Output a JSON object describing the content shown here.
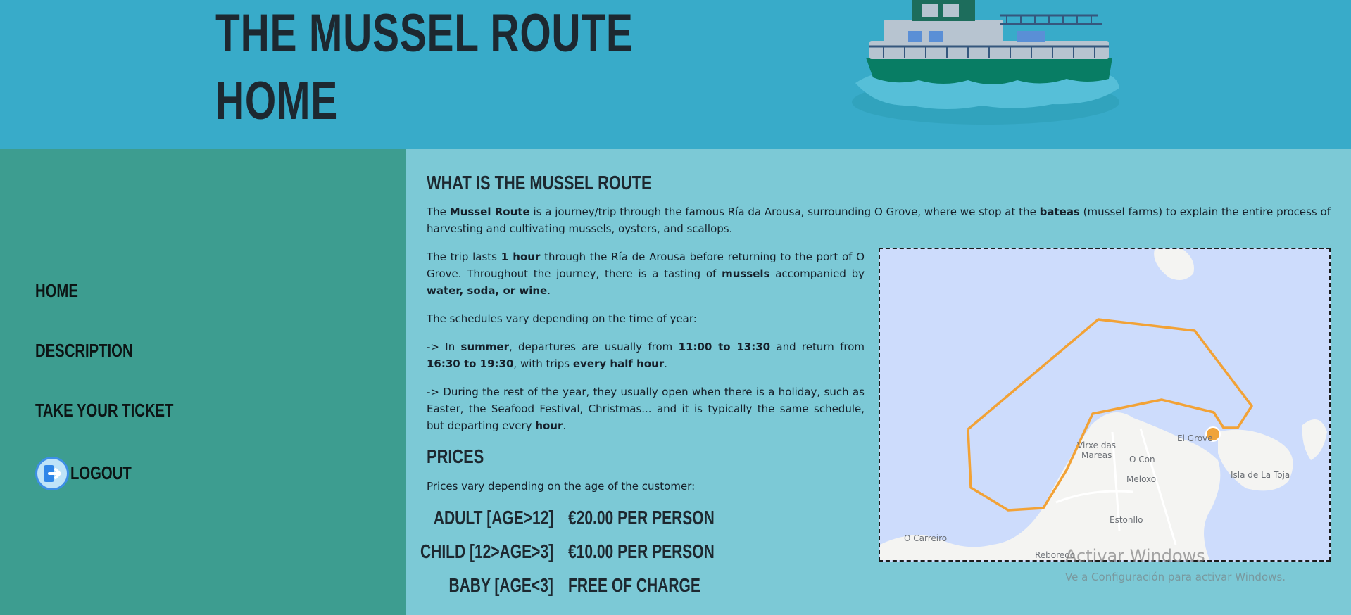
{
  "header": {
    "title_line1": "THE MUSSEL ROUTE",
    "title_line2": "HOME"
  },
  "nav": {
    "items": [
      {
        "label": "HOME"
      },
      {
        "label": "DESCRIPTION"
      },
      {
        "label": "TAKE YOUR TICKET"
      },
      {
        "label": "LOGOUT"
      }
    ]
  },
  "main": {
    "heading": "WHAT IS THE MUSSEL ROUTE",
    "intro": {
      "t1": "The ",
      "b1": "Mussel Route",
      "t2": " is a journey/trip through the famous Ría da Arousa, surrounding O Grove, where we stop at the ",
      "b2": "bateas",
      "t3": " (mussel farms) to explain the entire process of harvesting and cultivating mussels, oysters, and scallops."
    },
    "trip": {
      "t1": "The trip lasts ",
      "b1": "1 hour",
      "t2": " through the Ría de Arousa before returning to the port of O Grove. Throughout the journey, there is a tasting of ",
      "b2": "mussels",
      "t3": " accompanied by ",
      "b3": "water, soda, or wine",
      "t4": "."
    },
    "schedules": "The schedules vary depending on the time of year:",
    "summer": {
      "t1": "-> In ",
      "b1": "summer",
      "t2": ", departures are usually from ",
      "b2": "11:00 to 13:30",
      "t3": " and return from ",
      "b3": "16:30 to 19:30",
      "t4": ", with trips ",
      "b4": "every half hour",
      "t5": "."
    },
    "rest": {
      "t1": "-> During the rest of the year, they usually open when there is a holiday, such as Easter, the Seafood Festival, Christmas... and it is typically the same schedule, but departing every ",
      "b1": "hour",
      "t2": "."
    },
    "prices_heading": "PRICES",
    "prices_intro": "Prices vary depending on the age of the customer:",
    "prices": [
      {
        "label": "ADULT [AGE>12]",
        "value": "€20.00 PER PERSON"
      },
      {
        "label": "CHILD [12>AGE>3]",
        "value": "€10.00 PER PERSON"
      },
      {
        "label": "BABY [AGE<3]",
        "value": "FREE OF CHARGE"
      }
    ]
  },
  "map": {
    "labels": {
      "el_grove": "El Grove",
      "virxe": "Virxe das",
      "mareas": "Mareas",
      "o_con": "O Con",
      "meloxo": "Meloxo",
      "isla": "Isla de La Toja",
      "estonllo": "Estonllo",
      "carreiro": "O Carreiro",
      "reboredo": "Reboredo"
    },
    "route_color": "#f2a236",
    "water_color": "#cddcfc",
    "land_color": "#f4f4f2"
  },
  "watermark": {
    "line1": "Activar Windows",
    "line2": "Ve a Configuración para activar Windows."
  }
}
